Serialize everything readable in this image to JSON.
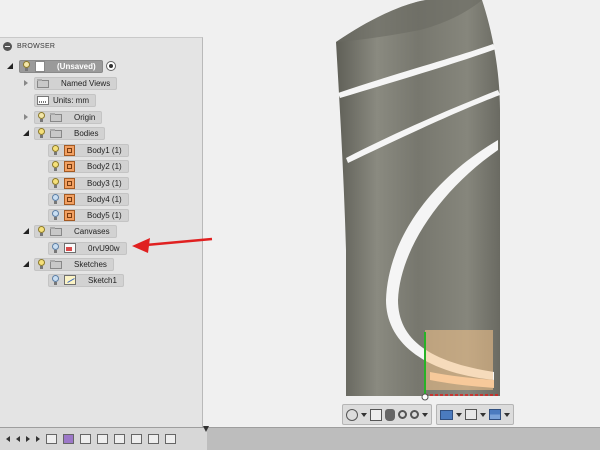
{
  "browser": {
    "title": "BROWSER",
    "root_label": "(Unsaved)",
    "items": [
      {
        "label": "Named Views"
      },
      {
        "label": "Units: mm"
      },
      {
        "label": "Origin"
      },
      {
        "label": "Bodies"
      },
      {
        "label": "Body1 (1)"
      },
      {
        "label": "Body2 (1)"
      },
      {
        "label": "Body3 (1)"
      },
      {
        "label": "Body4 (1)"
      },
      {
        "label": "Body5 (1)"
      },
      {
        "label": "Canvases"
      },
      {
        "label": "0rvU90w"
      },
      {
        "label": "Sketches"
      },
      {
        "label": "Sketch1"
      }
    ]
  },
  "colors": {
    "model_body": "#7b7b72",
    "annotation_arrow": "#e02020",
    "canvas_overlay": "#f5c58a",
    "axis_green": "#27b227",
    "axis_red": "#e01c1c"
  },
  "navbar": {
    "icons": [
      "orbit-icon",
      "look-at-icon",
      "pan-icon",
      "zoom-icon",
      "zoom-window-icon",
      "display-settings-icon",
      "grid-settings-icon",
      "viewports-icon"
    ]
  }
}
